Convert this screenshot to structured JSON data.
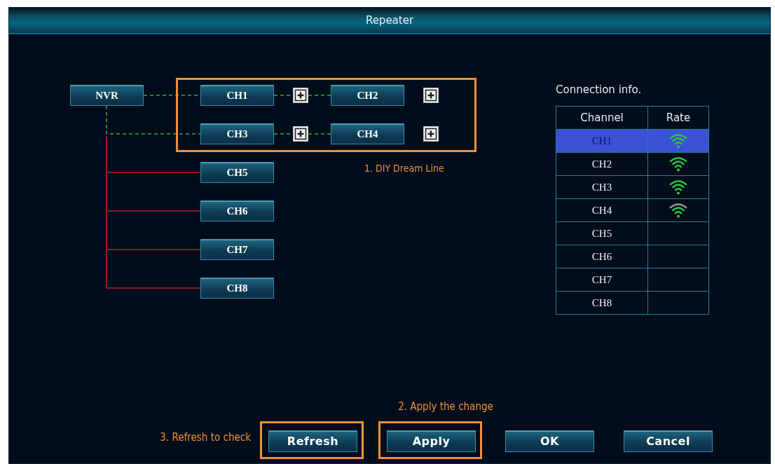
{
  "window": {
    "title": "Repeater"
  },
  "diagram": {
    "root": "NVR",
    "dream_line": {
      "highlighted": true,
      "annotation": "1. DIY Dream Line",
      "rows": [
        {
          "channels": [
            "CH1",
            "CH2"
          ]
        },
        {
          "channels": [
            "CH3",
            "CH4"
          ]
        }
      ]
    },
    "wired": [
      "CH5",
      "CH6",
      "CH7",
      "CH8"
    ]
  },
  "connection_info": {
    "title": "Connection info.",
    "columns": [
      "Channel",
      "Rate"
    ],
    "rows": [
      {
        "channel": "CH1",
        "selected": true,
        "kind": "strong"
      },
      {
        "channel": "CH2",
        "selected": false,
        "kind": "strong"
      },
      {
        "channel": "CH3",
        "selected": false,
        "kind": "strong"
      },
      {
        "channel": "CH4",
        "selected": false,
        "kind": "fair"
      },
      {
        "channel": "CH5",
        "selected": false,
        "kind": "none"
      },
      {
        "channel": "CH6",
        "selected": false,
        "kind": "none"
      },
      {
        "channel": "CH7",
        "selected": false,
        "kind": "none"
      },
      {
        "channel": "CH8",
        "selected": false,
        "kind": "none"
      }
    ]
  },
  "buttons": [
    {
      "label": "Refresh",
      "highlighted": true,
      "note": "3. Refresh to check",
      "kind": "leftnote"
    },
    {
      "label": "Apply",
      "highlighted": true,
      "note": "2. Apply the change",
      "kind": "topnote"
    },
    {
      "label": "OK",
      "highlighted": false
    },
    {
      "label": "Cancel",
      "highlighted": false
    }
  ]
}
